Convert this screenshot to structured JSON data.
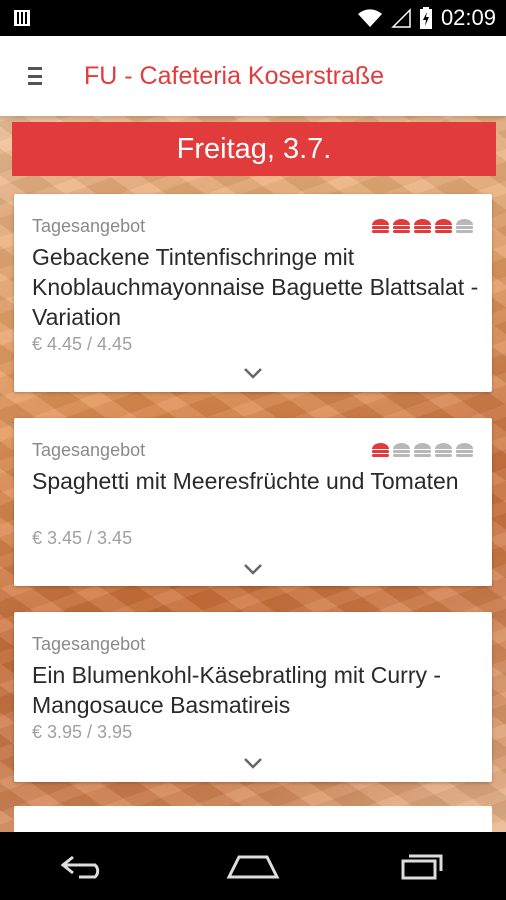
{
  "status_bar": {
    "time": "02:09",
    "icons": [
      "notification-icon",
      "wifi-icon",
      "signal-icon",
      "battery-icon"
    ]
  },
  "app_bar": {
    "title": "FU - Cafeteria Koserstraße",
    "menu_icon": "hamburger-menu-icon"
  },
  "day_banner": "Freitag, 3.7.",
  "colors": {
    "accent": "#e23b3b",
    "rating_active": "#e23b3b",
    "rating_inactive": "#b8b8b8"
  },
  "meals": [
    {
      "category": "Tagesangebot",
      "title": "Gebackene Tintenfischringe mit Knoblauchmayonnaise Baguette Blattsalat - Variation",
      "price": "€ 4.45 / 4.45",
      "rating": 4,
      "rating_max": 5
    },
    {
      "category": "Tagesangebot",
      "title": "Spaghetti mit Meeresfrüchte und Tomaten",
      "price": "€ 3.45 / 3.45",
      "rating": 1,
      "rating_max": 5
    },
    {
      "category": "Tagesangebot",
      "title": "Ein Blumenkohl-Käsebratling mit Curry - Mangosauce Basmatireis",
      "price": "€ 3.95 / 3.95",
      "rating": 0,
      "rating_max": 0
    }
  ],
  "nav_bar": {
    "buttons": [
      "back-icon",
      "home-icon",
      "recents-icon"
    ]
  }
}
